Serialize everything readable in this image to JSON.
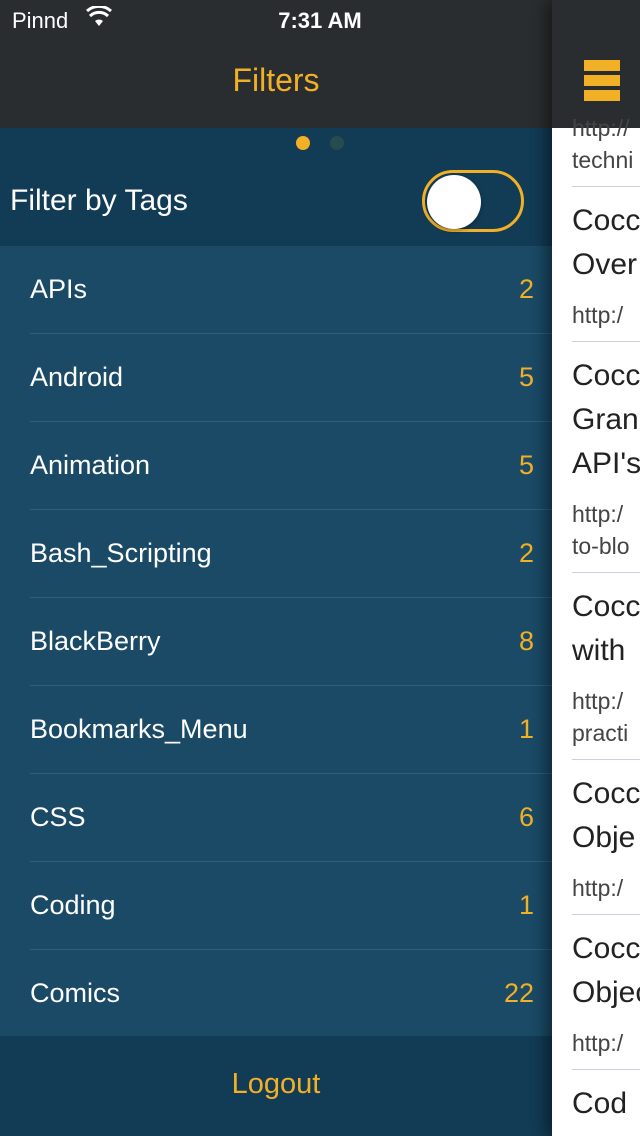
{
  "status_bar": {
    "carrier": "Pinnd",
    "time": "7:31 AM"
  },
  "nav": {
    "title": "Filters"
  },
  "filter": {
    "label": "Filter by Tags",
    "enabled": false
  },
  "page_indicator": {
    "current": 1,
    "total": 2
  },
  "tags": [
    {
      "name": "APIs",
      "count": "2"
    },
    {
      "name": "Android",
      "count": "5"
    },
    {
      "name": "Animation",
      "count": "5"
    },
    {
      "name": "Bash_Scripting",
      "count": "2"
    },
    {
      "name": "BlackBerry",
      "count": "8"
    },
    {
      "name": "Bookmarks_Menu",
      "count": "1"
    },
    {
      "name": "CSS",
      "count": "6"
    },
    {
      "name": "Coding",
      "count": "1"
    },
    {
      "name": "Comics",
      "count": "22"
    }
  ],
  "footer": {
    "logout_label": "Logout"
  },
  "content_peek": {
    "entries": [
      {
        "title_lines": [],
        "url_lines": [
          "http://",
          "techni"
        ]
      },
      {
        "title_lines": [
          "Cocc",
          "Over"
        ],
        "url_lines": [
          "http:/"
        ]
      },
      {
        "title_lines": [
          "Cocc",
          "Gran",
          "API's"
        ],
        "url_lines": [
          "http:/",
          "to-blo"
        ]
      },
      {
        "title_lines": [
          "Cocc",
          "with"
        ],
        "url_lines": [
          "http:/",
          "practi"
        ]
      },
      {
        "title_lines": [
          "Cocc",
          "Obje"
        ],
        "url_lines": [
          "http:/"
        ]
      },
      {
        "title_lines": [
          "Cocc",
          "Objec"
        ],
        "url_lines": [
          "http:/"
        ]
      },
      {
        "title_lines": [
          "Cod"
        ],
        "url_lines": []
      }
    ]
  },
  "colors": {
    "accent": "#f2b027",
    "panel": "#1a4a66",
    "header": "#123b55",
    "bar": "#2a2d2f"
  },
  "icons": [
    "wifi-icon",
    "battery-icon",
    "hamburger-menu-icon"
  ]
}
